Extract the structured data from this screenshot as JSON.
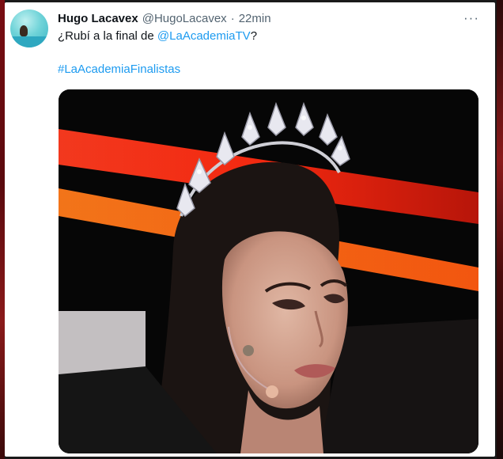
{
  "tweet": {
    "display_name": "Hugo Lacavex",
    "handle": "@HugoLacavex",
    "separator": "·",
    "time": "22min",
    "more_label": "···",
    "text_before": "¿Rubí a la final de ",
    "mention": "@LaAcademiaTV",
    "text_after": "?",
    "hashtag": "#LaAcademiaFinalistas"
  },
  "icons": {
    "avatar": "profile-avatar-beach",
    "more": "more-options-icon"
  },
  "colors": {
    "link": "#1d9bf0",
    "text": "#0f1419",
    "muted": "#536471"
  }
}
